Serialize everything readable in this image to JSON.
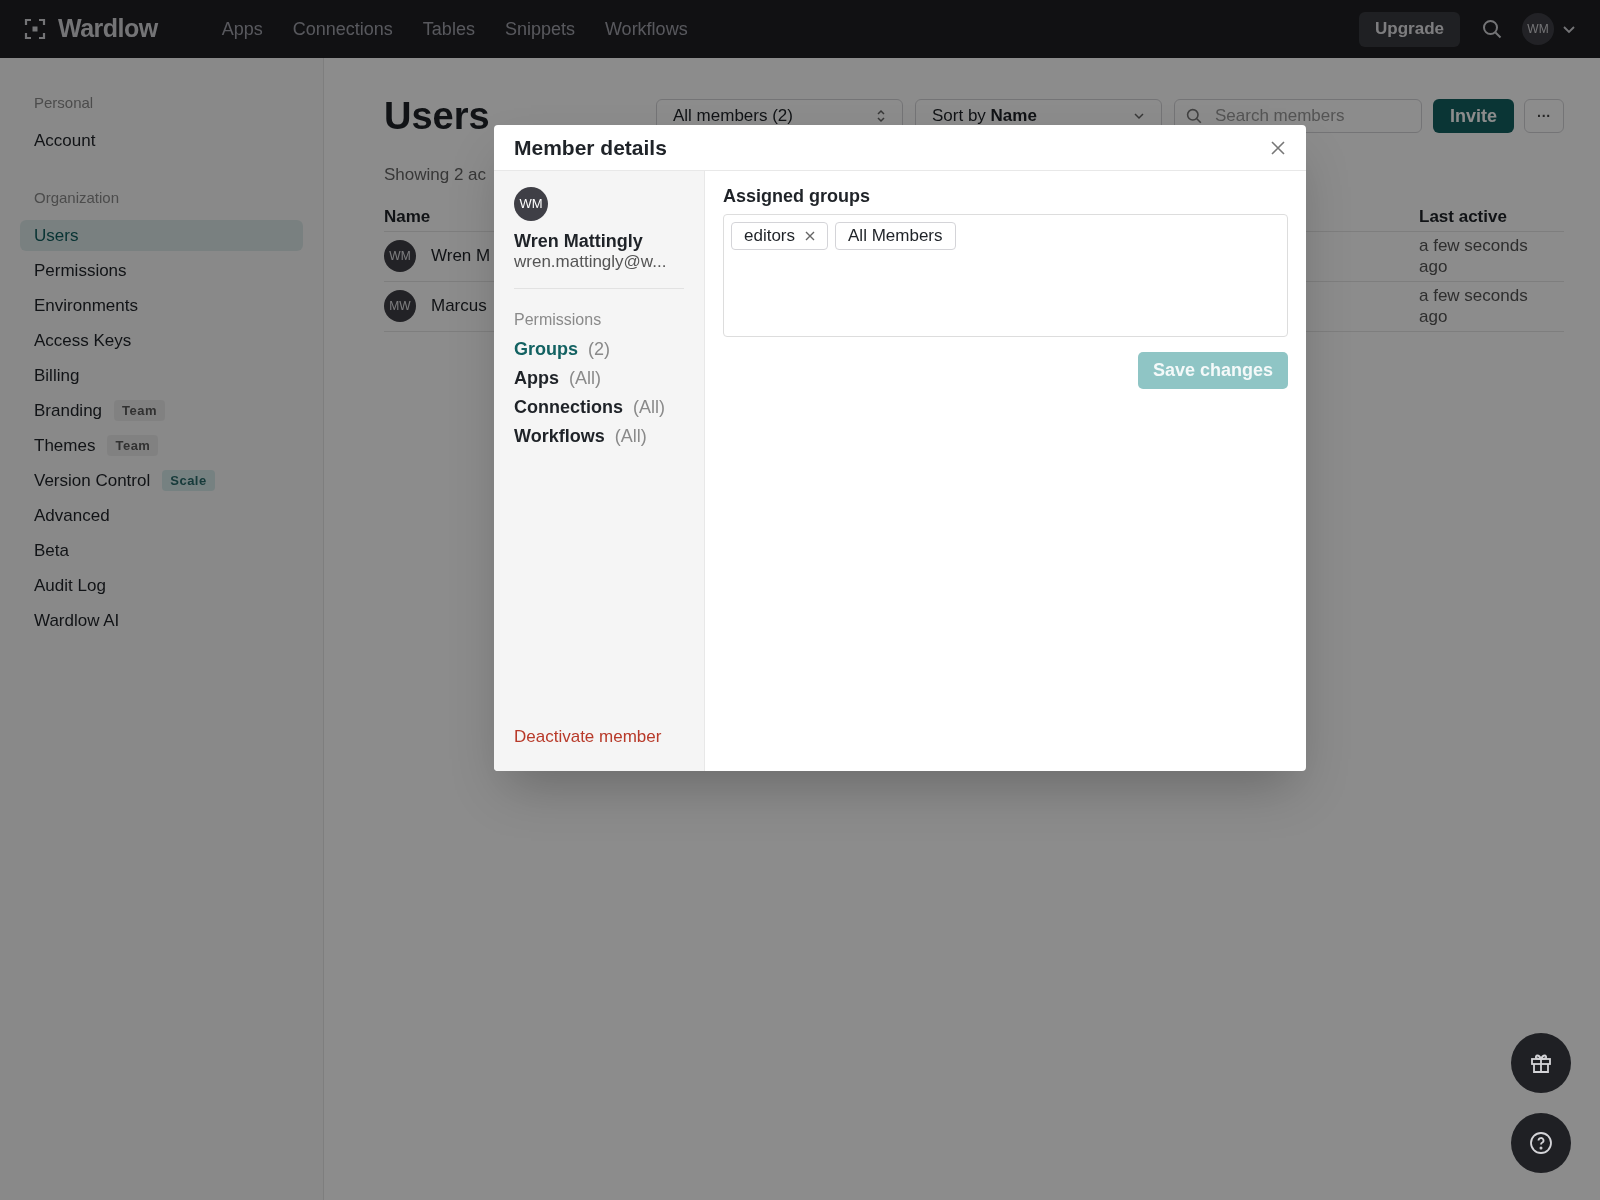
{
  "topbar": {
    "brand": "Wardlow",
    "nav": [
      "Apps",
      "Connections",
      "Tables",
      "Snippets",
      "Workflows"
    ],
    "upgrade": "Upgrade",
    "avatar": "WM"
  },
  "sidebar": {
    "sections": [
      {
        "heading": "Personal",
        "items": [
          {
            "label": "Account",
            "selected": false
          }
        ]
      },
      {
        "heading": "Organization",
        "items": [
          {
            "label": "Users",
            "selected": true
          },
          {
            "label": "Permissions",
            "selected": false
          },
          {
            "label": "Environments",
            "selected": false
          },
          {
            "label": "Access Keys",
            "selected": false
          },
          {
            "label": "Billing",
            "selected": false
          },
          {
            "label": "Branding",
            "selected": false,
            "badge": {
              "text": "Team",
              "kind": "neutral"
            }
          },
          {
            "label": "Themes",
            "selected": false,
            "badge": {
              "text": "Team",
              "kind": "neutral"
            }
          },
          {
            "label": "Version Control",
            "selected": false,
            "badge": {
              "text": "Scale",
              "kind": "accent"
            }
          },
          {
            "label": "Advanced",
            "selected": false
          },
          {
            "label": "Beta",
            "selected": false
          },
          {
            "label": "Audit Log",
            "selected": false
          },
          {
            "label": "Wardlow AI",
            "selected": false
          }
        ]
      }
    ]
  },
  "page": {
    "title": "Users",
    "filter": "All members (2)",
    "sort_prefix": "Sort by",
    "sort_value": "Name",
    "search": {
      "placeholder": "Search members"
    },
    "invite": "Invite",
    "more": "···",
    "summary": "Showing 2 ac",
    "table": {
      "columns": [
        "Name",
        "Last active"
      ],
      "rows": [
        {
          "avatar": "WM",
          "name": "Wren M",
          "last_active": "a few seconds ago"
        },
        {
          "avatar": "MW",
          "name": "Marcus",
          "last_active": "a few seconds ago"
        }
      ]
    }
  },
  "modal": {
    "title": "Member details",
    "member": {
      "avatar": "WM",
      "name": "Wren Mattingly",
      "email": "wren.mattingly@w..."
    },
    "permissions_heading": "Permissions",
    "permissions": [
      {
        "label": "Groups",
        "count": "(2)",
        "selected": true
      },
      {
        "label": "Apps",
        "count": "(All)",
        "selected": false
      },
      {
        "label": "Connections",
        "count": "(All)",
        "selected": false
      },
      {
        "label": "Workflows",
        "count": "(All)",
        "selected": false
      }
    ],
    "deactivate": "Deactivate member",
    "section_title": "Assigned groups",
    "groups": [
      {
        "label": "editors",
        "removable": true
      },
      {
        "label": "All Members",
        "removable": false
      }
    ],
    "save": {
      "label": "Save changes",
      "disabled": true
    }
  }
}
